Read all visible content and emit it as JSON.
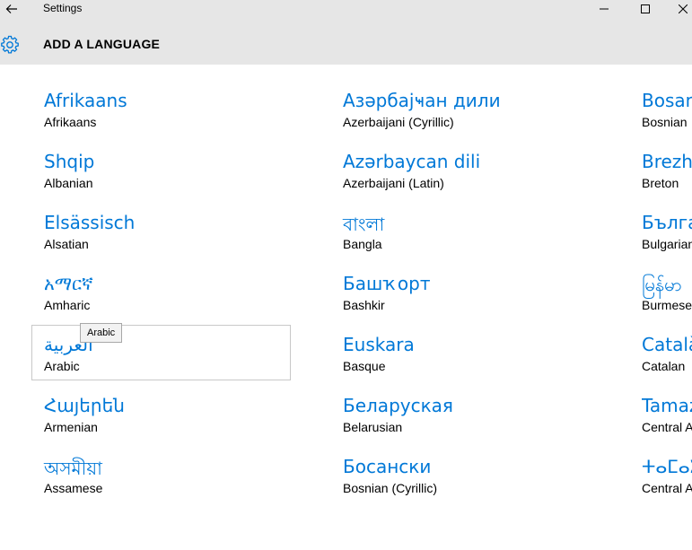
{
  "window": {
    "title": "Settings",
    "controls": [
      "minimize",
      "maximize",
      "close"
    ]
  },
  "header": {
    "title": "ADD A LANGUAGE",
    "icon": "gear-icon"
  },
  "accent_color": "#0078d7",
  "tooltip": {
    "text": "Arabic"
  },
  "languages": {
    "col1": [
      {
        "native": "Afrikaans",
        "english": "Afrikaans"
      },
      {
        "native": "Shqip",
        "english": "Albanian"
      },
      {
        "native": "Elsässisch",
        "english": "Alsatian"
      },
      {
        "native": "አማርኛ",
        "english": "Amharic"
      },
      {
        "native": "العربية",
        "english": "Arabic"
      },
      {
        "native": "Հայերեն",
        "english": "Armenian"
      },
      {
        "native": "অসমীয়া",
        "english": "Assamese"
      }
    ],
    "col2": [
      {
        "native": "Азәрбајҹан дили",
        "english": "Azerbaijani (Cyrillic)"
      },
      {
        "native": "Azərbaycan dili",
        "english": "Azerbaijani (Latin)"
      },
      {
        "native": "বাংলা",
        "english": "Bangla"
      },
      {
        "native": "Башҡорт",
        "english": "Bashkir"
      },
      {
        "native": "Euskara",
        "english": "Basque"
      },
      {
        "native": "Беларуская",
        "english": "Belarusian"
      },
      {
        "native": "Босански",
        "english": "Bosnian (Cyrillic)"
      }
    ],
    "col3": [
      {
        "native": "Bosan",
        "english": "Bosnian"
      },
      {
        "native": "Brezho",
        "english": "Breton"
      },
      {
        "native": "Бълга",
        "english": "Bulgarian"
      },
      {
        "native": "မြန်မာ",
        "english": "Burmese"
      },
      {
        "native": "Català",
        "english": "Catalan"
      },
      {
        "native": "Tamaz",
        "english": "Central A"
      },
      {
        "native": "ⵜⴰⵎⴰⵣ",
        "english": "Central A"
      }
    ]
  }
}
